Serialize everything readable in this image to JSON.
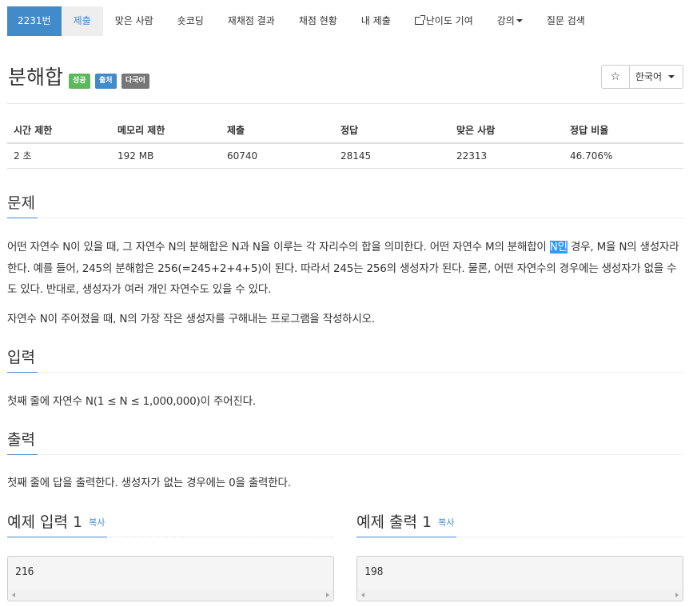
{
  "nav": {
    "items": [
      {
        "label": "2231번"
      },
      {
        "label": "제출"
      },
      {
        "label": "맞은 사람"
      },
      {
        "label": "숏코딩"
      },
      {
        "label": "재채점 결과"
      },
      {
        "label": "채점 현황"
      },
      {
        "label": "내 제출"
      },
      {
        "label": "난이도 기여"
      },
      {
        "label": "강의"
      },
      {
        "label": "질문 검색"
      }
    ]
  },
  "problem": {
    "title": "분해합",
    "labels": {
      "success": "성공",
      "source": "출처",
      "multilang": "다국어"
    },
    "star": "☆",
    "language": "한국어"
  },
  "info": {
    "headers": [
      "시간 제한",
      "메모리 제한",
      "제출",
      "정답",
      "맞은 사람",
      "정답 비율"
    ],
    "values": [
      "2 초",
      "192 MB",
      "60740",
      "28145",
      "22313",
      "46.706%"
    ]
  },
  "sections": {
    "problem": {
      "heading": "문제",
      "p1_before": "어떤 자연수 N이 있을 때, 그 자연수 N의 분해합은 N과 N을 이루는 각 자리수의 합을 의미한다. 어떤 자연수 M의 분해합이 ",
      "p1_highlight": "N인",
      "p1_after": " 경우, M을 N의 생성자라 한다. 예를 들어, 245의 분해합은 256(=245+2+4+5)이 된다. 따라서 245는 256의 생성자가 된다. 물론, 어떤 자연수의 경우에는 생성자가 없을 수도 있다. 반대로, 생성자가 여러 개인 자연수도 있을 수 있다.",
      "p2": "자연수 N이 주어졌을 때, N의 가장 작은 생성자를 구해내는 프로그램을 작성하시오."
    },
    "input": {
      "heading": "입력",
      "text": "첫째 줄에 자연수 N(1 ≤ N ≤ 1,000,000)이 주어진다."
    },
    "output": {
      "heading": "출력",
      "text": "첫째 줄에 답을 출력한다. 생성자가 없는 경우에는 0을 출력한다."
    }
  },
  "samples": {
    "input": {
      "heading": "예제 입력 1",
      "copy": "복사",
      "value": "216"
    },
    "output": {
      "heading": "예제 출력 1",
      "copy": "복사",
      "value": "198"
    }
  }
}
